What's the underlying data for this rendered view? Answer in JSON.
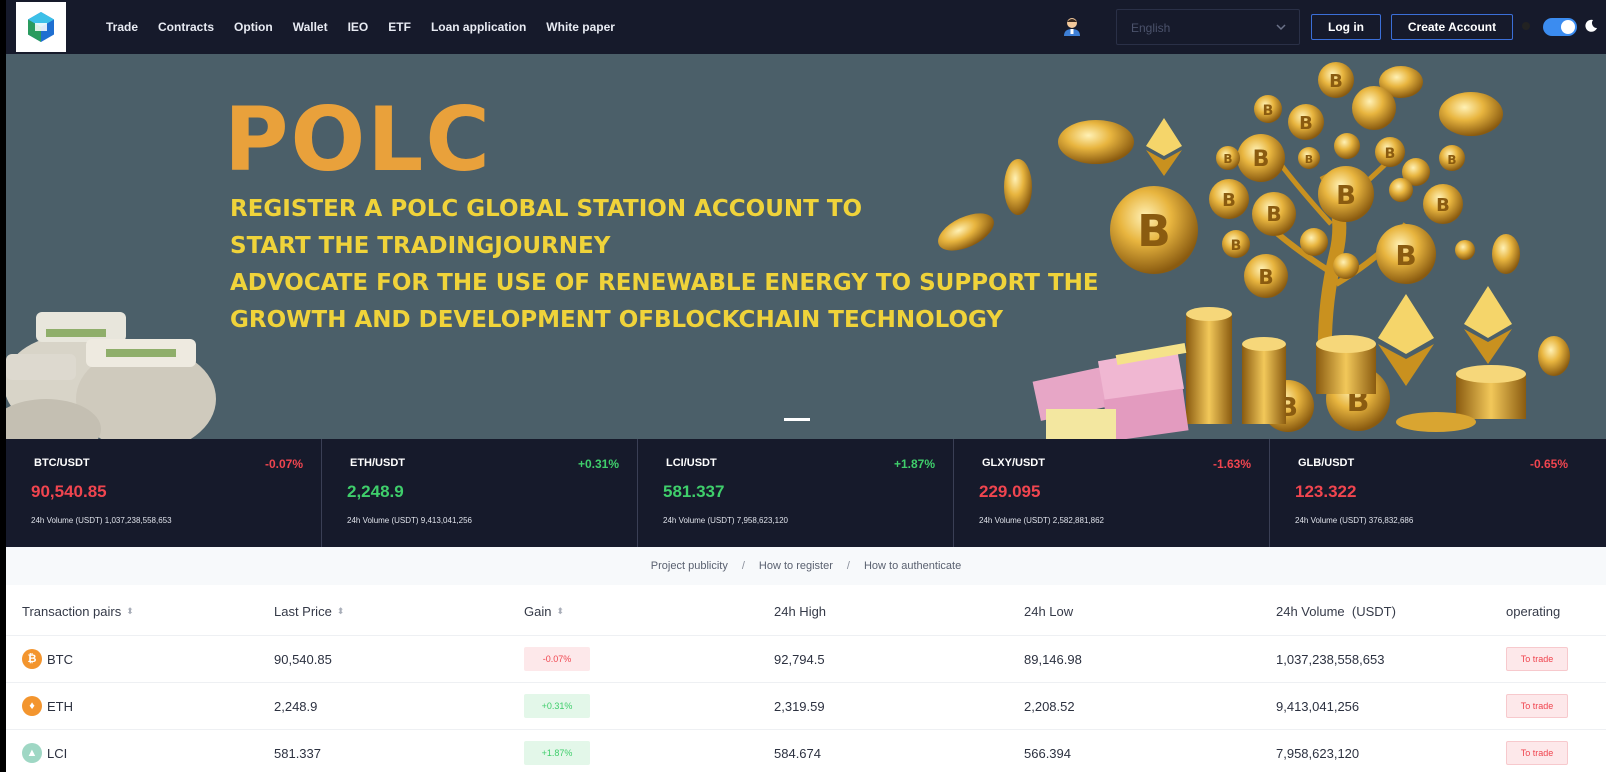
{
  "nav": {
    "links": [
      "Trade",
      "Contracts",
      "Option",
      "Wallet",
      "IEO",
      "ETF",
      "Loan application",
      "White paper"
    ],
    "language": "English",
    "login": "Log in",
    "create_account": "Create Account",
    "dark_mode": true
  },
  "hero": {
    "title": "POLC",
    "lines": [
      "REGISTER A POLC GLOBAL STATION ACCOUNT TO",
      "START THE TRADINGJOURNEY",
      "ADVOCATE FOR THE USE OF RENEWABLE ENERGY TO SUPPORT THE",
      "GROWTH AND DEVELOPMENT OFBLOCKCHAIN TECHNOLOGY"
    ],
    "title_color": "#e9a13b",
    "text_color": "#f0d33a"
  },
  "ticker": [
    {
      "pair": "BTC/USDT",
      "change": "-0.07%",
      "price": "90,540.85",
      "volume": "24h Volume  (USDT)   1,037,238,558,653",
      "dir": "down"
    },
    {
      "pair": "ETH/USDT",
      "change": "+0.31%",
      "price": "2,248.9",
      "volume": "24h Volume  (USDT)   9,413,041,256",
      "dir": "up"
    },
    {
      "pair": "LCI/USDT",
      "change": "+1.87%",
      "price": "581.337",
      "volume": "24h Volume  (USDT)   7,958,623,120",
      "dir": "up"
    },
    {
      "pair": "GLXY/USDT",
      "change": "-1.63%",
      "price": "229.095",
      "volume": "24h Volume  (USDT)   2,582,881,862",
      "dir": "down"
    },
    {
      "pair": "GLB/USDT",
      "change": "-0.65%",
      "price": "123.322",
      "volume": "24h Volume  (USDT)   376,832,686",
      "dir": "down"
    }
  ],
  "info_links": [
    "Project publicity",
    "How to register",
    "How to authenticate"
  ],
  "info_sep": "/",
  "table": {
    "headers": [
      "Transaction pairs",
      "Last Price",
      "Gain",
      "24h High",
      "24h Low",
      "24h Volume  (USDT)",
      "operating"
    ],
    "rows": [
      {
        "coin": "BTC",
        "icon": "bitcoin-icon",
        "icon_color": "#f3952e",
        "icon_char": "₿",
        "last": "90,540.85",
        "gain": "-0.07%",
        "gain_dir": "neg",
        "high": "92,794.5",
        "low": "89,146.98",
        "volume": "1,037,238,558,653",
        "action": "To trade"
      },
      {
        "coin": "ETH",
        "icon": "ethereum-icon",
        "icon_color": "#f3952e",
        "icon_char": "♦",
        "last": "2,248.9",
        "gain": "+0.31%",
        "gain_dir": "pos",
        "high": "2,319.59",
        "low": "2,208.52",
        "volume": "9,413,041,256",
        "action": "To trade"
      },
      {
        "coin": "LCI",
        "icon": "lci-icon",
        "icon_color": "#9fd7c4",
        "icon_char": "▲",
        "last": "581.337",
        "gain": "+1.87%",
        "gain_dir": "pos",
        "high": "584.674",
        "low": "566.394",
        "volume": "7,958,623,120",
        "action": "To trade"
      }
    ]
  }
}
